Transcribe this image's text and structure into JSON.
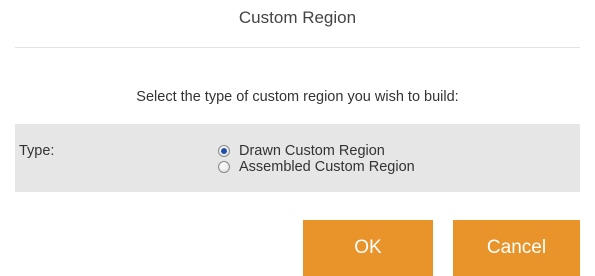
{
  "dialog": {
    "title": "Custom Region",
    "prompt": "Select the type of custom region you wish to build:",
    "type_label": "Type:",
    "options": [
      {
        "label": "Drawn Custom Region",
        "selected": true
      },
      {
        "label": "Assembled Custom Region",
        "selected": false
      }
    ],
    "buttons": {
      "ok_label": "OK",
      "cancel_label": "Cancel"
    },
    "colors": {
      "button": "#e8942a",
      "row_background": "#e6e6e6",
      "radio_selected": "#1f4fa8"
    }
  }
}
